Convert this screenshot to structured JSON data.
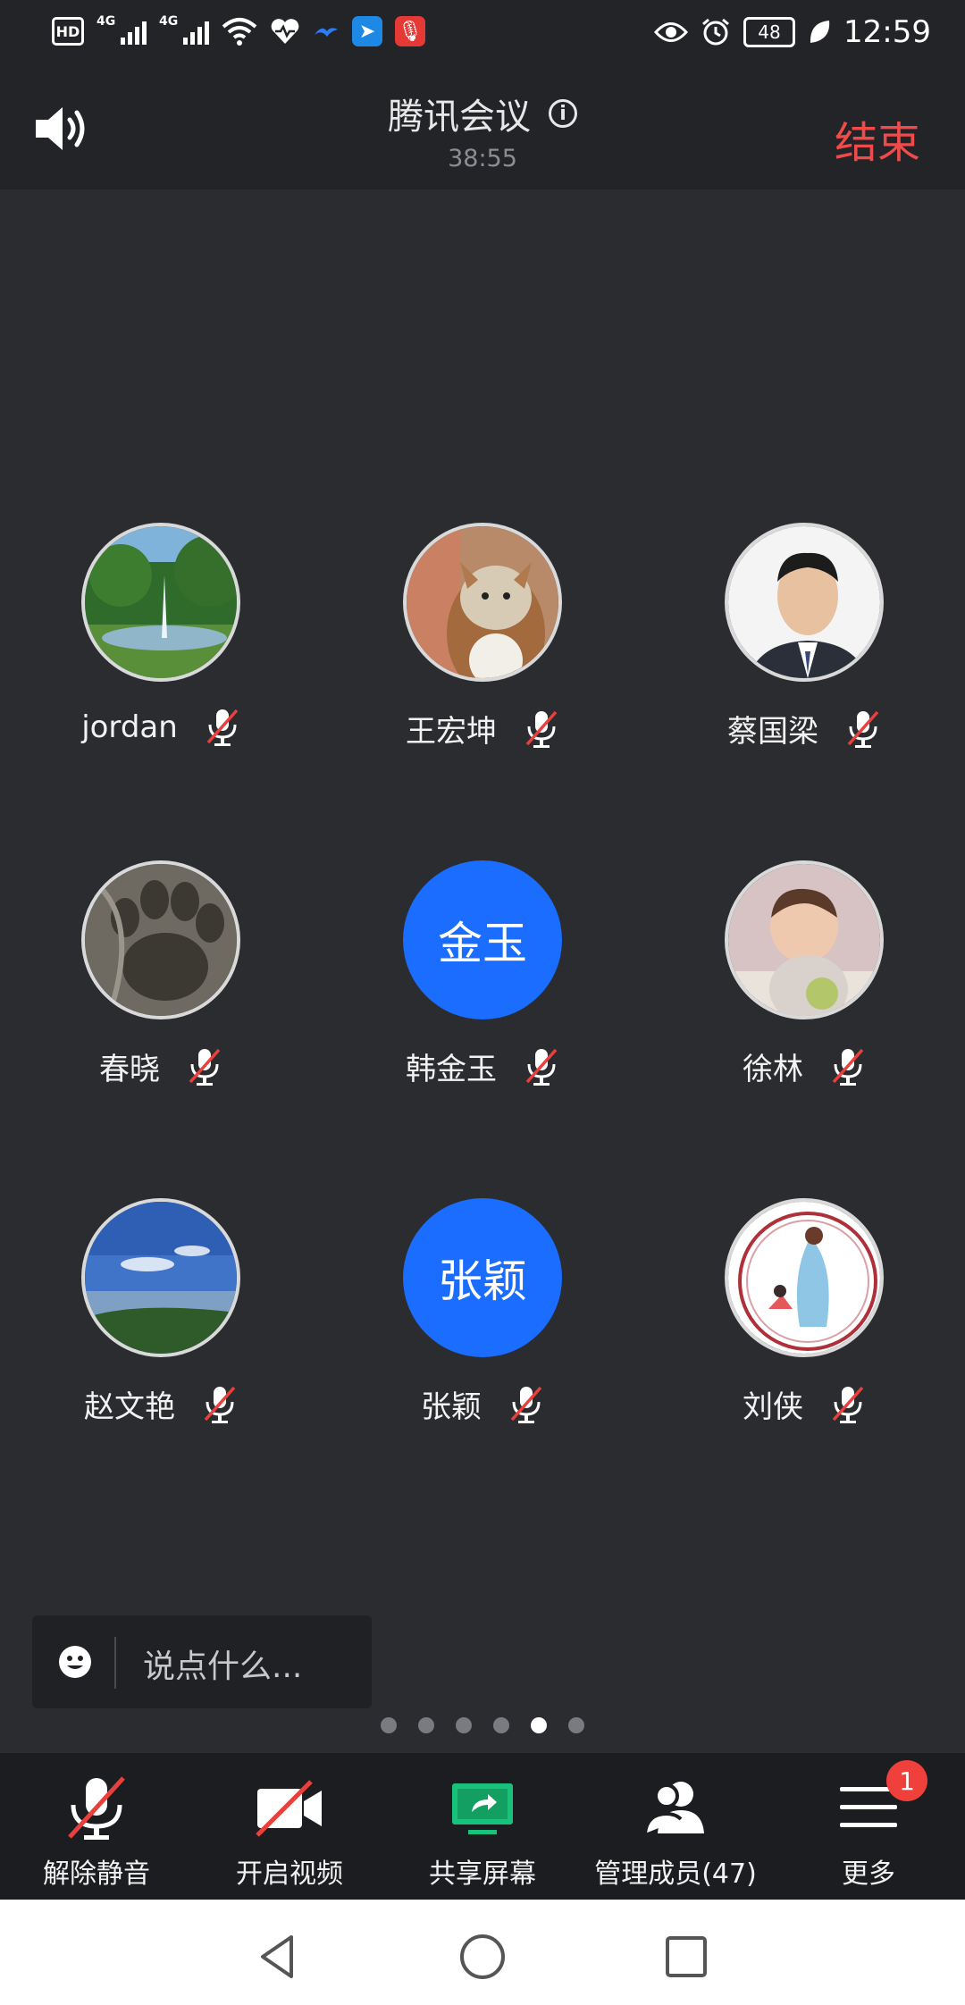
{
  "status_bar": {
    "hd_label": "HD",
    "signal_1": "4G",
    "signal_2": "4G",
    "battery": "48",
    "time": "12:59"
  },
  "header": {
    "title": "腾讯会议",
    "timer": "38:55",
    "end_label": "结束"
  },
  "participants": [
    {
      "name": "jordan",
      "avatar_type": "photo",
      "avatar_desc": "fountain-park"
    },
    {
      "name": "王宏坤",
      "avatar_type": "photo",
      "avatar_desc": "dog"
    },
    {
      "name": "蔡国梁",
      "avatar_type": "photo",
      "avatar_desc": "man-portrait"
    },
    {
      "name": "春晓",
      "avatar_type": "photo",
      "avatar_desc": "paw-print"
    },
    {
      "name": "韩金玉",
      "avatar_type": "text",
      "avatar_text": "金玉"
    },
    {
      "name": "徐林",
      "avatar_type": "photo",
      "avatar_desc": "baby"
    },
    {
      "name": "赵文艳",
      "avatar_type": "photo",
      "avatar_desc": "sky-landscape"
    },
    {
      "name": "张颖",
      "avatar_type": "text",
      "avatar_text": "张颖"
    },
    {
      "name": "刘侠",
      "avatar_type": "photo",
      "avatar_desc": "illustration"
    }
  ],
  "chat": {
    "placeholder": "说点什么..."
  },
  "pager": {
    "total": 6,
    "active": 5
  },
  "toolbar": {
    "unmute_label": "解除静音",
    "video_label": "开启视频",
    "share_label": "共享屏幕",
    "members_label": "管理成员(47)",
    "more_label": "更多",
    "more_badge": "1"
  },
  "colors": {
    "accent_blue": "#1a6dff",
    "end_red": "#f04b4b",
    "mute_red": "#e8403c",
    "share_green": "#19c27a",
    "background": "#2b2c30"
  }
}
